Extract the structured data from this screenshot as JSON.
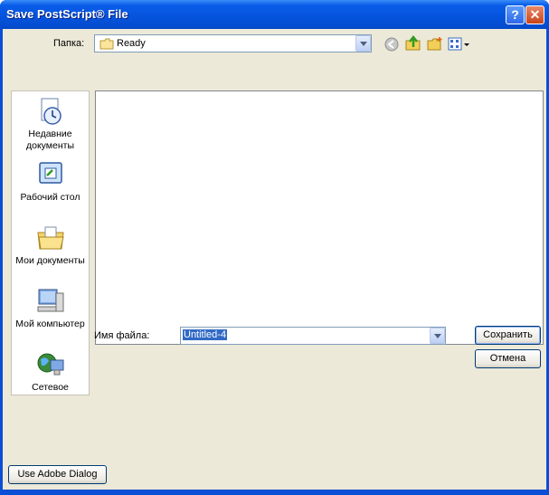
{
  "window": {
    "title": "Save PostScript® File",
    "help_glyph": "?",
    "close_glyph": "✕"
  },
  "lookin": {
    "label": "Папка:",
    "value": "Ready"
  },
  "toolbar": {
    "icons": [
      "back-icon",
      "up-folder-icon",
      "new-folder-icon",
      "view-menu-icon"
    ]
  },
  "places": [
    {
      "id": "recent",
      "label": "Недавние документы",
      "icon": "recent-documents-icon"
    },
    {
      "id": "desktop",
      "label": "Рабочий стол",
      "icon": "desktop-icon"
    },
    {
      "id": "mydocs",
      "label": "Мои документы",
      "icon": "my-documents-icon"
    },
    {
      "id": "mycomputer",
      "label": "Мой компьютер",
      "icon": "my-computer-icon"
    },
    {
      "id": "network",
      "label": "Сетевое",
      "icon": "network-icon"
    }
  ],
  "filename": {
    "label": "Имя файла:",
    "value": "Untitled-4"
  },
  "buttons": {
    "save": "Сохранить",
    "cancel": "Отмена",
    "adobe": "Use Adobe Dialog"
  },
  "colors": {
    "titlebar": "#0553dd",
    "client": "#ece9d8",
    "selection": "#316ac5"
  }
}
